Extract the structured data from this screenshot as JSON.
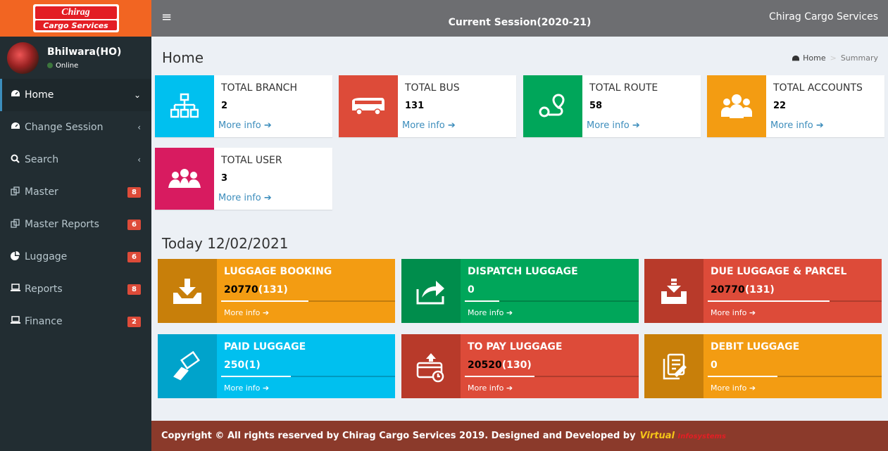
{
  "logo": {
    "top": "Chirag",
    "bottom": "Cargo Services"
  },
  "user": {
    "name": "Bhilwara(HO)",
    "status": "Online"
  },
  "menu": [
    {
      "label": "Home",
      "chevron": "⌄",
      "active": true
    },
    {
      "label": "Change Session",
      "chevron": "‹"
    },
    {
      "label": "Search",
      "chevron": "‹"
    },
    {
      "label": "Master",
      "badge": "8"
    },
    {
      "label": "Master Reports",
      "badge": "6"
    },
    {
      "label": "Luggage",
      "badge": "6"
    },
    {
      "label": "Reports",
      "badge": "8"
    },
    {
      "label": "Finance",
      "badge": "2"
    }
  ],
  "header": {
    "session": "Current Session(2020-21)",
    "brand": "Chirag Cargo Services"
  },
  "content": {
    "title": "Home",
    "breadcrumb": [
      "Home",
      "Summary"
    ]
  },
  "info_boxes": [
    {
      "title": "TOTAL BRANCH",
      "value": "2",
      "more": "More info",
      "color": "#00c0ef",
      "icon": "sitemap-icon"
    },
    {
      "title": "TOTAL BUS",
      "value": "131",
      "more": "More info",
      "color": "#dd4b39",
      "icon": "bus-icon"
    },
    {
      "title": "TOTAL ROUTE",
      "value": "58",
      "more": "More info",
      "color": "#00a65a",
      "icon": "route-icon"
    },
    {
      "title": "TOTAL ACCOUNTS",
      "value": "22",
      "more": "More info",
      "color": "#f39c12",
      "icon": "users-icon"
    },
    {
      "title": "TOTAL USER",
      "value": "3",
      "more": "More info",
      "color": "#d81b60",
      "icon": "user-group-icon"
    }
  ],
  "today": "Today 12/02/2021",
  "luggage_boxes": [
    {
      "title": "LUGGAGE BOOKING",
      "v1": "20770",
      "v2": "(131)",
      "more": "More info",
      "color": "#f39c12",
      "icon": "download-tray-icon",
      "progress": 0.5
    },
    {
      "title": "DISPATCH LUGGAGE",
      "v1": "",
      "v2": "0",
      "more": "More info",
      "color": "#00a65a",
      "icon": "share-icon",
      "progress": 0.2
    },
    {
      "title": "DUE LUGGAGE & PARCEL",
      "v1": "20770",
      "v2": "(131)",
      "more": "More info",
      "color": "#dd4b39",
      "icon": "inbox-icon",
      "progress": 0.7
    },
    {
      "title": "PAID LUGGAGE",
      "v1": "",
      "v2": "250(1)",
      "more": "More info",
      "color": "#00c0ef",
      "icon": "pay-hand-icon",
      "progress": 0.4
    },
    {
      "title": "TO PAY LUGGAGE",
      "v1": "20520",
      "v2": "(130)",
      "more": "More info",
      "color": "#dd4b39",
      "icon": "card-clock-icon",
      "progress": 0.4
    },
    {
      "title": "DEBIT LUGGAGE",
      "v1": "",
      "v2": "0",
      "more": "More info",
      "color": "#f39c12",
      "icon": "document-edit-icon",
      "progress": 0.4
    }
  ],
  "footer": {
    "text": "Copyright © All rights reserved by Chirag Cargo Services 2019. Designed and Developed by",
    "logo_v": "Virtual",
    "logo_in": "Infosystems"
  }
}
